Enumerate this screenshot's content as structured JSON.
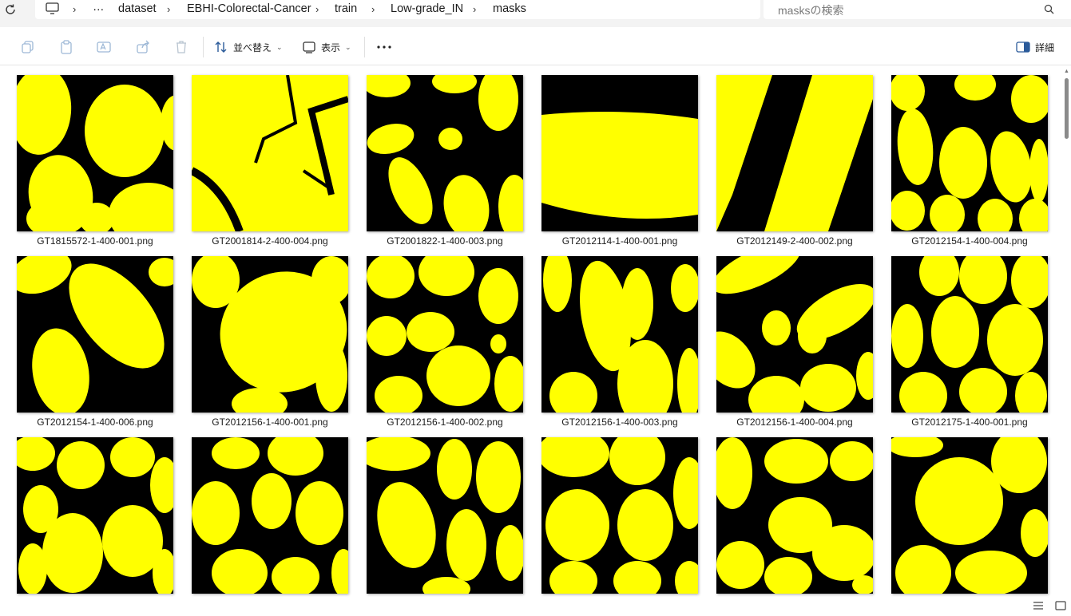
{
  "addressbar": {
    "breadcrumbs": [
      "…",
      "dataset",
      "EBHI-Colorectal-Cancer",
      "train",
      "Low-grade_IN",
      "masks"
    ],
    "search_placeholder": "masksの検索"
  },
  "toolbar": {
    "sort_label": "並べ替え",
    "view_label": "表示",
    "details_label": "詳細"
  },
  "colors": {
    "mask_fg": "#ffff00",
    "mask_bg": "#000000"
  },
  "files": [
    "GT1815572-1-400-001.png",
    "GT2001814-2-400-004.png",
    "GT2001822-1-400-003.png",
    "GT2012114-1-400-001.png",
    "GT2012149-2-400-002.png",
    "GT2012154-1-400-004.png",
    "GT2012154-1-400-006.png",
    "GT2012156-1-400-001.png",
    "GT2012156-1-400-002.png",
    "GT2012156-1-400-003.png",
    "GT2012156-1-400-004.png",
    "GT2012175-1-400-001.png",
    "",
    "",
    "",
    "",
    "",
    ""
  ]
}
